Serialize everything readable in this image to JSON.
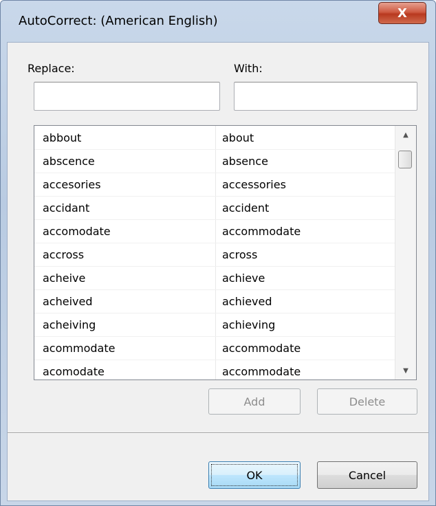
{
  "window": {
    "title": "AutoCorrect: (American English)",
    "close_glyph": "X"
  },
  "form": {
    "replace_label": "Replace:",
    "with_label": "With:",
    "replace_value": "",
    "with_value": ""
  },
  "list": {
    "rows": [
      {
        "replace": "abbout",
        "with": "about"
      },
      {
        "replace": "abscence",
        "with": "absence"
      },
      {
        "replace": "accesories",
        "with": "accessories"
      },
      {
        "replace": "accidant",
        "with": "accident"
      },
      {
        "replace": "accomodate",
        "with": "accommodate"
      },
      {
        "replace": "accross",
        "with": "across"
      },
      {
        "replace": "acheive",
        "with": "achieve"
      },
      {
        "replace": "acheived",
        "with": "achieved"
      },
      {
        "replace": "acheiving",
        "with": "achieving"
      },
      {
        "replace": "acommodate",
        "with": "accommodate"
      },
      {
        "replace": "acomodate",
        "with": "accommodate"
      }
    ],
    "scroll_up_icon": "▲",
    "scroll_down_icon": "▼"
  },
  "buttons": {
    "add": "Add",
    "delete": "Delete",
    "ok": "OK",
    "cancel": "Cancel"
  },
  "colors": {
    "close_button": "#c9482e",
    "default_button_border": "#3c7fb1",
    "dialog_background": "#f0f0f0"
  }
}
